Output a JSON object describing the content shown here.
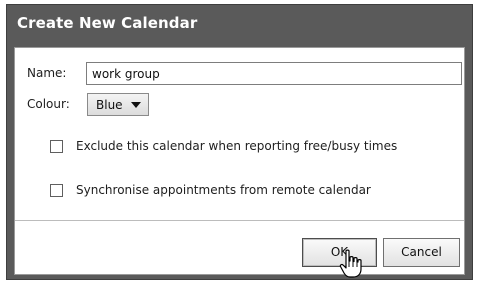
{
  "dialog": {
    "title": "Create New Calendar"
  },
  "form": {
    "name_label": "Name:",
    "name_value": "work group",
    "colour_label": "Colour:",
    "colour_selected": "Blue",
    "exclude_label": "Exclude this calendar when reporting free/busy times",
    "exclude_checked": false,
    "sync_label": "Synchronise appointments from remote calendar",
    "sync_checked": false
  },
  "buttons": {
    "ok_label": "OK",
    "cancel_label": "Cancel"
  },
  "icons": {
    "colour_dropdown": "triangle-down-icon",
    "mouse_cursor": "hand-pointer-icon"
  },
  "colors": {
    "dialog_background": "#5a5a5a",
    "title_text": "#ffffff",
    "panel_background": "#ffffff"
  }
}
